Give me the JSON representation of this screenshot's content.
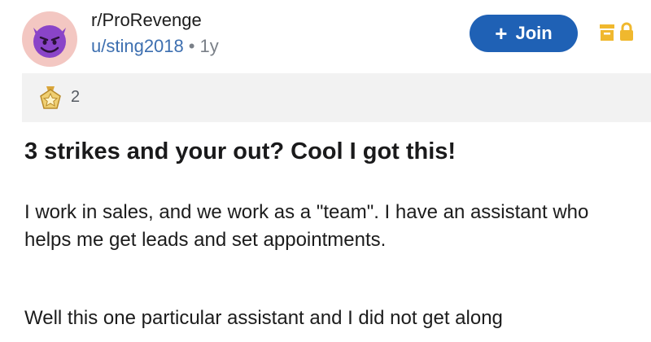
{
  "post_header": {
    "subreddit": "r/ProRevenge",
    "username": "u/sting2018",
    "separator": "•",
    "age": "1y",
    "join_label": "Join",
    "avatar_icon": "devil-emoji-icon",
    "archive_icon": "archive-icon",
    "lock_icon": "lock-icon",
    "accent_color": "#1f61b5"
  },
  "awards": {
    "icon": "award-medal-icon",
    "count": "2"
  },
  "post": {
    "title": "3 strikes and your out? Cool I got this!",
    "paragraph1": "I work in sales, and we work as a \"team\". I have an assistant who helps me get leads and set appointments.",
    "paragraph2_visible": "Well this one particular assistant and I did not get along"
  }
}
